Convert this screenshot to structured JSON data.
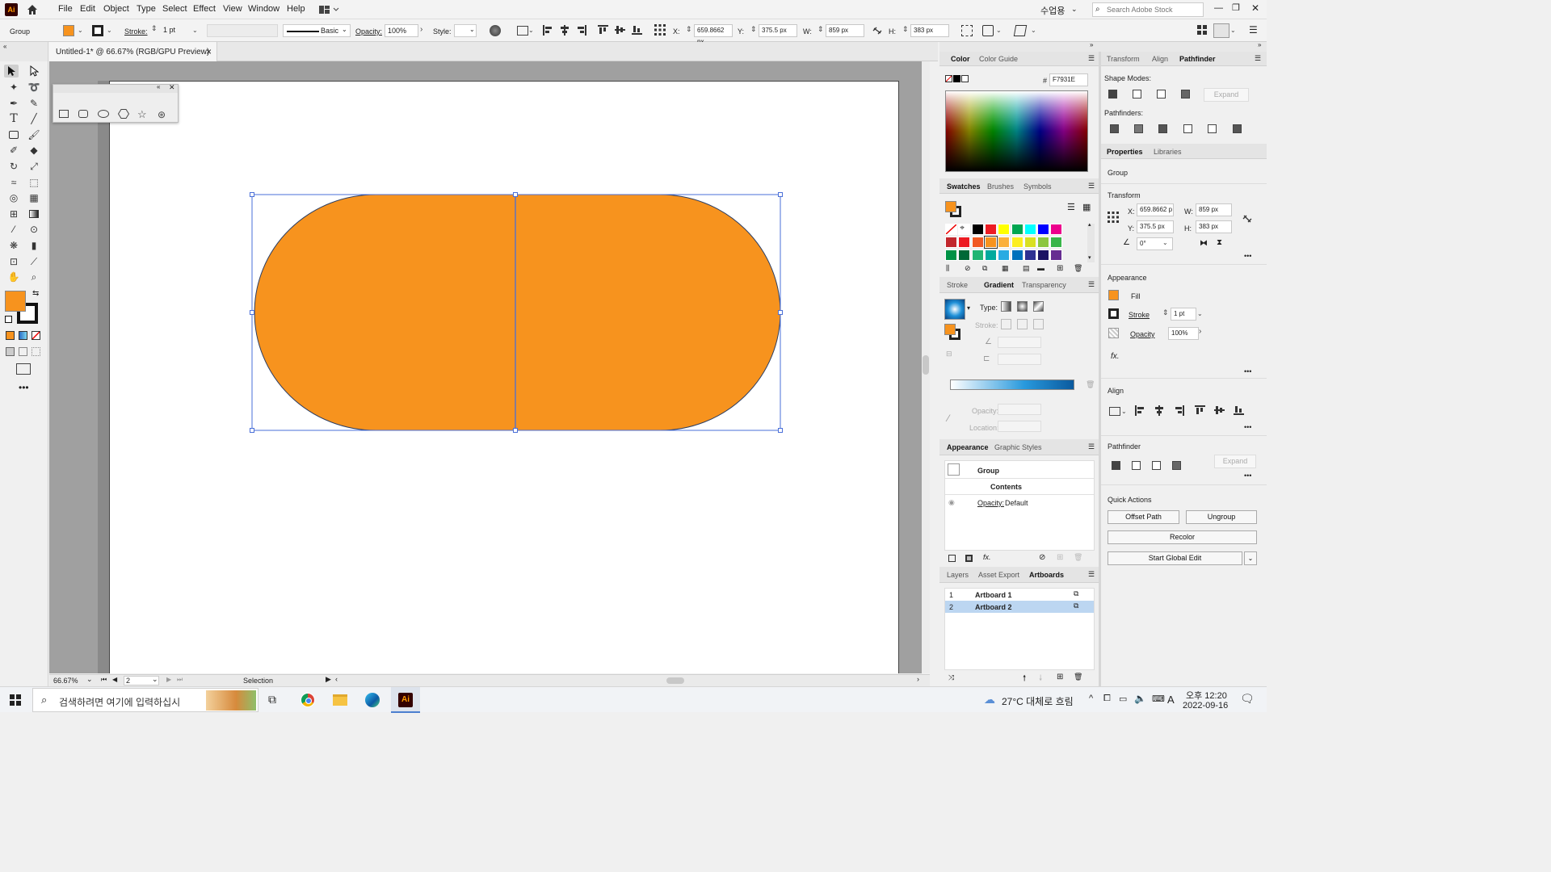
{
  "app": {
    "logo": "Ai",
    "home_icon": "home-icon"
  },
  "menu": [
    "File",
    "Edit",
    "Object",
    "Type",
    "Select",
    "Effect",
    "View",
    "Window",
    "Help"
  ],
  "workspace": "수업용",
  "search": {
    "placeholder": "Search Adobe Stock"
  },
  "control": {
    "selection_label": "Group",
    "stroke_label": "Stroke:",
    "stroke_weight": "1 pt",
    "brush_label": "Basic",
    "opacity_label": "Opacity:",
    "opacity_value": "100%",
    "style_label": "Style:",
    "x_label": "X:",
    "x_value": "659.8662 px",
    "y_label": "Y:",
    "y_value": "375.5 px",
    "w_label": "W:",
    "w_value": "859 px",
    "h_label": "H:",
    "h_value": "383 px"
  },
  "document": {
    "tab_title": "Untitled-1* @ 66.67% (RGB/GPU Preview)",
    "close": "×"
  },
  "status": {
    "zoom": "66.67%",
    "artboard": "2",
    "mode": "Selection"
  },
  "colors": {
    "fill": "#F7931E",
    "selection": "#4a6fd8",
    "stroke": "#2c3e63"
  },
  "color_panel": {
    "tabs": [
      "Color",
      "Color Guide"
    ],
    "hex_label": "#",
    "hex_value": "F7931E"
  },
  "swatches_panel": {
    "tabs": [
      "Swatches",
      "Brushes",
      "Symbols"
    ],
    "row1": [
      "#ffffff",
      "#ffffff",
      "#000000",
      "#ed1c24",
      "#ffff00",
      "#00a651",
      "#00ffff",
      "#0000ff",
      "#ec008c"
    ],
    "row2": [
      "#c1272d",
      "#ed1c24",
      "#f15a24",
      "#f7931e",
      "#fbb03b",
      "#fcee21",
      "#d9e021",
      "#8cc63f",
      "#39b54a"
    ],
    "row3": [
      "#009245",
      "#006837",
      "#22b573",
      "#00a99d",
      "#29abe2",
      "#0071bc",
      "#2e3192",
      "#1b1464",
      "#662d91"
    ],
    "row4": [
      "#93278f",
      "#9e005d",
      "#d4145a",
      "#ed1e79",
      "#c7b299",
      "#998675",
      "#736357",
      "#534741",
      "#c69c6d"
    ]
  },
  "gradient_panel": {
    "tabs": [
      "Stroke",
      "Gradient",
      "Transparency"
    ],
    "type_label": "Type:",
    "stroke_label": "Stroke:",
    "opacity_label": "Opacity:",
    "location_label": "Location:"
  },
  "appearance_panel": {
    "tabs": [
      "Appearance",
      "Graphic Styles"
    ],
    "group": "Group",
    "contents": "Contents",
    "opacity_label": "Opacity:",
    "opacity_value": "Default"
  },
  "artboards_panel": {
    "tabs": [
      "Layers",
      "Asset Export",
      "Artboards"
    ],
    "rows": [
      {
        "num": "1",
        "name": "Artboard 1"
      },
      {
        "num": "2",
        "name": "Artboard 2"
      }
    ]
  },
  "top_right_tabs": [
    "Transform",
    "Align",
    "Pathfinder"
  ],
  "pathfinder": {
    "shape_modes": "Shape Modes:",
    "expand": "Expand",
    "pathfinders": "Pathfinders:"
  },
  "properties": {
    "tabs": [
      "Properties",
      "Libraries"
    ],
    "selection": "Group",
    "transform_title": "Transform",
    "x_label": "X:",
    "x_value": "659.8662 p",
    "y_label": "Y:",
    "y_value": "375.5 px",
    "w_label": "W:",
    "w_value": "859 px",
    "h_label": "H:",
    "h_value": "383 px",
    "angle_value": "0°",
    "appearance_title": "Appearance",
    "fill_label": "Fill",
    "stroke_label": "Stroke",
    "stroke_value": "1 pt",
    "opacity_label": "Opacity",
    "opacity_value": "100%",
    "fx": "fx.",
    "align_title": "Align",
    "pathfinder_title": "Pathfinder",
    "expand": "Expand",
    "quick_actions_title": "Quick Actions",
    "offset_path": "Offset Path",
    "ungroup": "Ungroup",
    "recolor": "Recolor",
    "start_global_edit": "Start Global Edit",
    "more": "•••"
  },
  "taskbar": {
    "search_placeholder": "검색하려면 여기에 입력하십시",
    "weather": "27°C 대체로 흐림",
    "time": "오후 12:20",
    "date": "2022-09-16",
    "ime": "A"
  }
}
